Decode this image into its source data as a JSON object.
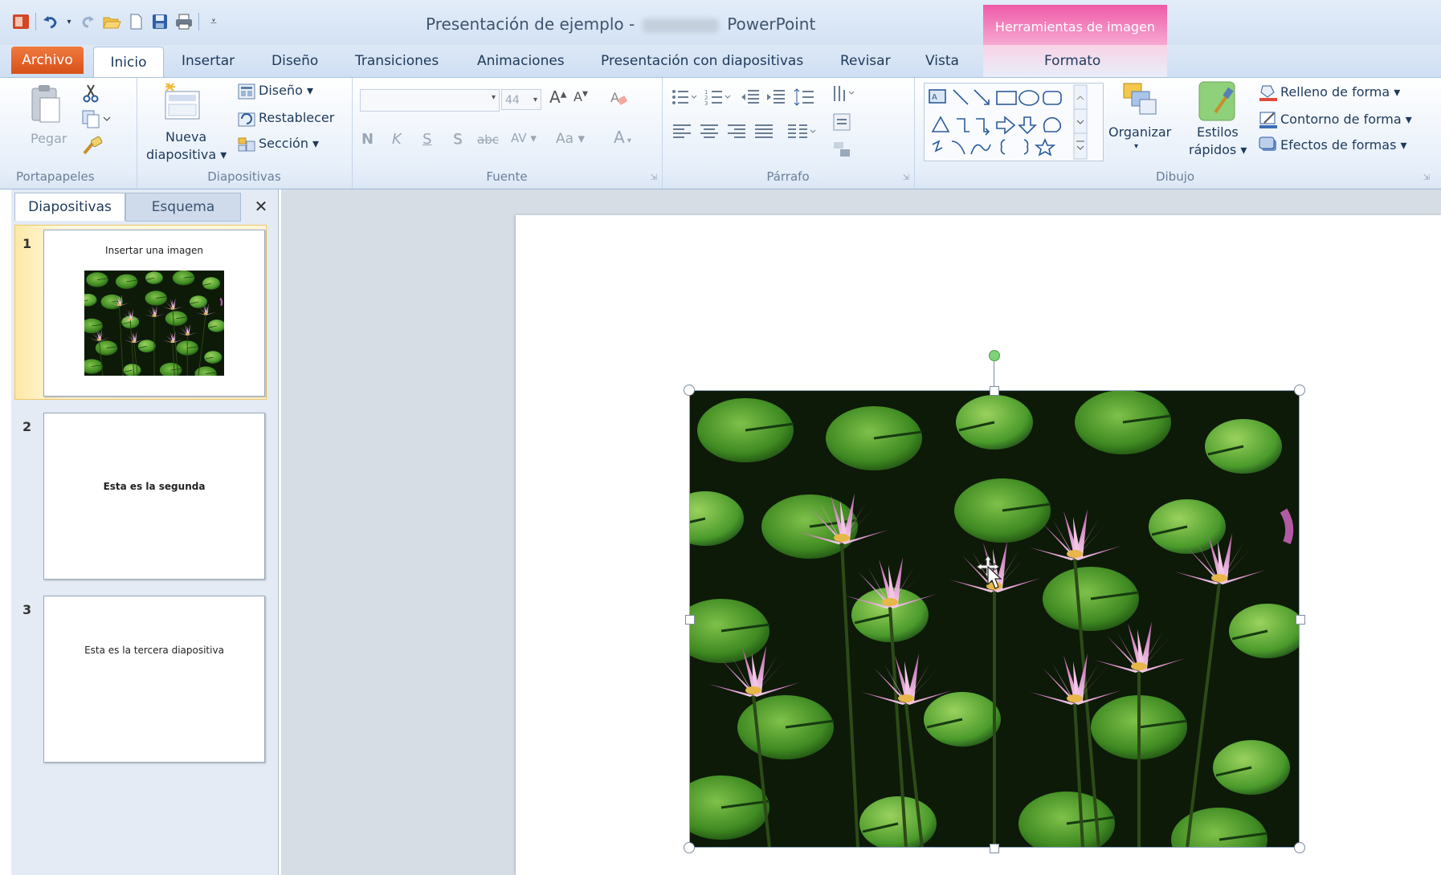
{
  "window": {
    "title_prefix": "Presentación de ejemplo  -",
    "title_app": "PowerPoint",
    "context_tool_title": "Herramientas de imagen"
  },
  "quick_access": [
    "powerpoint-logo-icon",
    "undo-icon",
    "redo-icon",
    "open-icon",
    "new-icon",
    "save-icon",
    "print-icon",
    "customize-icon"
  ],
  "tabs": {
    "archivo": "Archivo",
    "inicio": "Inicio",
    "insertar": "Insertar",
    "diseno": "Diseño",
    "transiciones": "Transiciones",
    "animaciones": "Animaciones",
    "presentacion": "Presentación con diapositivas",
    "revisar": "Revisar",
    "vista": "Vista",
    "formato": "Formato"
  },
  "ribbon": {
    "portapapeles": {
      "label": "Portapapeles",
      "pegar": "Pegar"
    },
    "diapositivas": {
      "label": "Diapositivas",
      "nueva_line1": "Nueva",
      "nueva_line2": "diapositiva ▾",
      "diseno": "Diseño ▾",
      "restablecer": "Restablecer",
      "seccion": "Sección ▾"
    },
    "fuente": {
      "label": "Fuente",
      "font_name": "",
      "font_size": "44",
      "bold": "N",
      "italic": "K",
      "underline": "S",
      "shadow": "S",
      "strike": "abc",
      "spacing": "AV",
      "case": "Aa",
      "grow": "A",
      "shrink": "A",
      "color": "A"
    },
    "parrafo": {
      "label": "Párrafo"
    },
    "dibujo": {
      "label": "Dibujo",
      "organizar": "Organizar",
      "estilos_line1": "Estilos",
      "estilos_line2": "rápidos ▾",
      "relleno": "Relleno de forma ▾",
      "contorno": "Contorno de forma ▾",
      "efectos": "Efectos de formas ▾"
    }
  },
  "slide_panel": {
    "tab_diapositivas": "Diapositivas",
    "tab_esquema": "Esquema",
    "close": "✕",
    "slides": [
      {
        "number": "1",
        "text": "Insertar una imagen"
      },
      {
        "number": "2",
        "text": "Esta es la segunda"
      },
      {
        "number": "3",
        "text": "Esta es la tercera diapositiva"
      }
    ]
  },
  "colors": {
    "archivo_tab": "#e0632a",
    "context_band": "#ee5aa8",
    "ribbon_text": "#1e395b",
    "thumb_selected": "#fde9a6"
  }
}
